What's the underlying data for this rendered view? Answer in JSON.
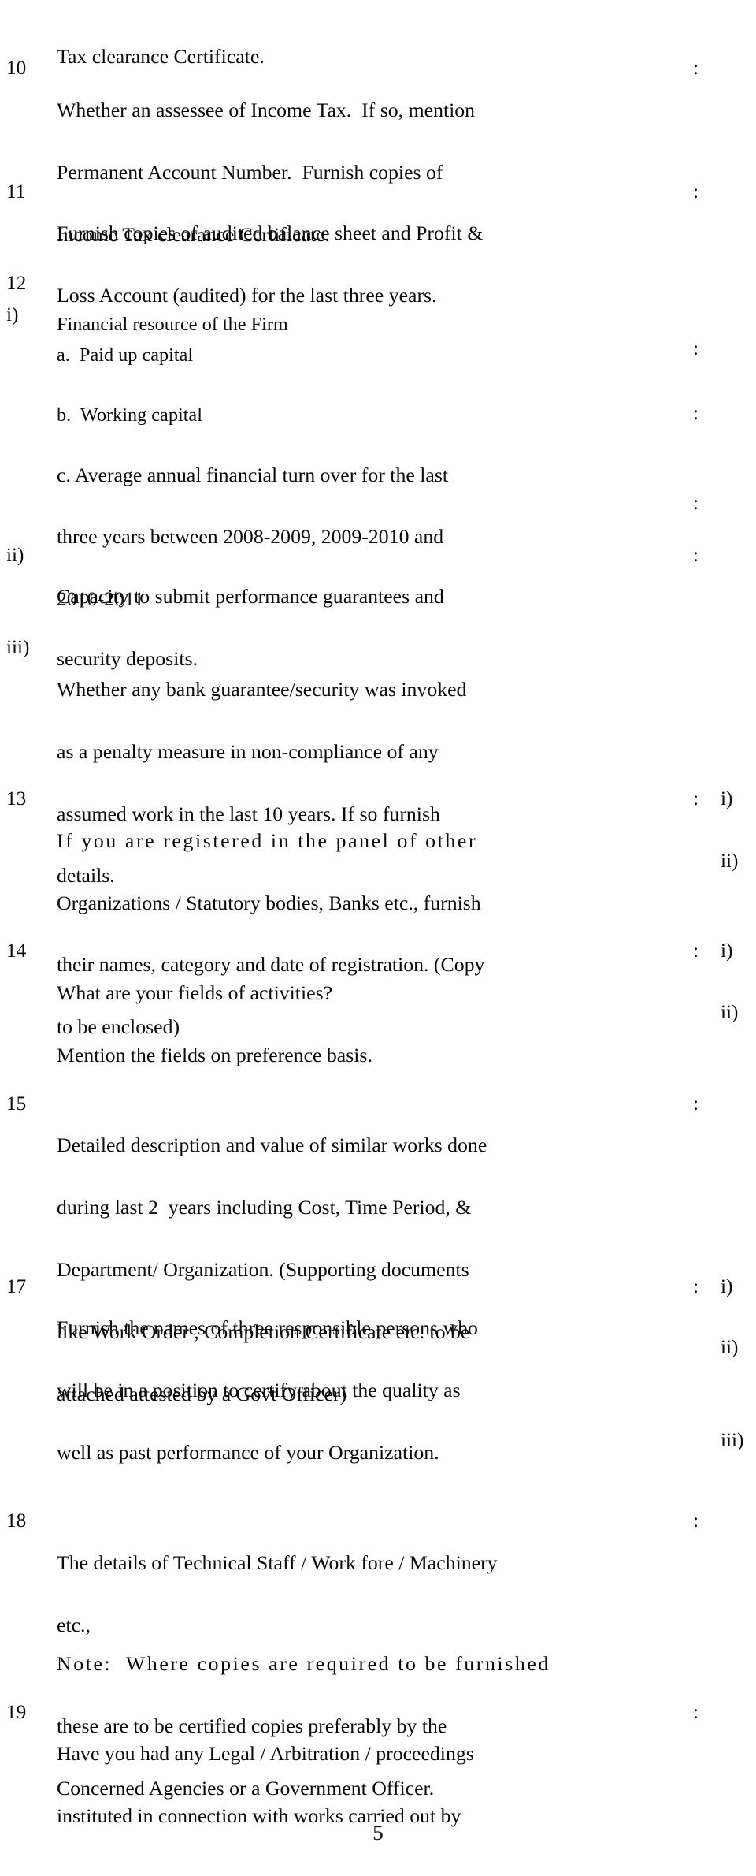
{
  "document": {
    "type": "tender-application-form",
    "page_number": "5"
  },
  "items": [
    {
      "number": "",
      "lines": [
        "Tax clearance Certificate."
      ],
      "colon": "",
      "answers": []
    },
    {
      "number": "10",
      "lines": [
        "Whether an assessee of Income Tax.  If so, mention",
        "Permanent Account Number.  Furnish copies of",
        "Income Tax clearance Certificate."
      ],
      "colon": ":",
      "answers": []
    },
    {
      "number": "11",
      "lines": [
        "Furnish copies of audited balance sheet and Profit &",
        "Loss Account (audited) for the last three years."
      ],
      "colon": ":",
      "answers": []
    },
    {
      "number": "12",
      "lines": [
        "Financial resource of the Firm"
      ],
      "colon": "",
      "answers": []
    },
    {
      "number": "i)",
      "lines": [
        "a.  Paid up capital"
      ],
      "colon": "",
      "answers": []
    },
    {
      "number": "",
      "lines": [
        "b.  Working capital"
      ],
      "colon": ":",
      "answers": []
    },
    {
      "number": "",
      "lines": [
        "c. Average annual financial turn over for the last",
        "three years between 2008-2009, 2009-2010 and",
        "2010-2011"
      ],
      "colon": ":",
      "answers": []
    },
    {
      "number": "ii)",
      "lines": [
        "Capacity to submit performance guarantees and",
        "security deposits."
      ],
      "colon": ":",
      "answers": []
    },
    {
      "number": "iii)",
      "lines": [
        "Whether any bank guarantee/security was invoked",
        "as a penalty measure in non-compliance of any",
        "assumed work in the last 10 years. If so furnish",
        "details."
      ],
      "colon": "",
      "answers": []
    },
    {
      "number": "13",
      "lines": [
        "If you are registered in the panel of other",
        "Organizations / Statutory bodies, Banks etc., furnish",
        "their names, category and date of registration. (Copy",
        "to be enclosed)"
      ],
      "colon": ":",
      "answers": [
        "i)",
        "ii)"
      ]
    },
    {
      "number": "14",
      "lines": [
        "What are your fields of activities?",
        "Mention the fields on preference basis."
      ],
      "colon": ":",
      "answers": [
        "i)",
        "ii)"
      ]
    },
    {
      "number": "15",
      "lines": [
        "Detailed description and value of similar works done",
        "during last 2  years including Cost, Time Period, &",
        "Department/ Organization. (Supporting documents",
        "like Work Order , Completion Certificate etc. to be",
        "attached attested by a Govt Officer)"
      ],
      "colon": ":",
      "answers": []
    },
    {
      "number": "17",
      "lines": [
        "Furnish the names of three responsible persons who",
        "will be in a position to certify about the quality as",
        "well as past performance of your Organization."
      ],
      "colon": ":",
      "answers": [
        "i)",
        "ii)",
        "iii)"
      ]
    },
    {
      "number": "18",
      "lines": [
        "The details of Technical Staff / Work fore / Machinery",
        "etc.,"
      ],
      "colon": ":",
      "answers": []
    },
    {
      "number": "",
      "lines": [
        "Note:  Where copies are required to be furnished",
        "these are to be certified copies preferably by the",
        "Concerned Agencies or a Government Officer."
      ],
      "colon": "",
      "answers": []
    },
    {
      "number": "19",
      "lines": [
        "Have you had any Legal / Arbitration / proceedings",
        "instituted in connection with works carried out by"
      ],
      "colon": ":",
      "answers": []
    }
  ],
  "blocks": {
    "b0_line0": "Tax clearance Certificate.",
    "b1_num": "10",
    "b1_line0": "Whether an assessee of Income Tax.  If so, mention",
    "b1_line1": "Permanent Account Number.  Furnish copies of",
    "b1_line2": "Income Tax clearance Certificate.",
    "b1_colon": ":",
    "b2_num": "11",
    "b2_line0": "Furnish copies of audited balance sheet and Profit &",
    "b2_line1": "Loss Account (audited) for the last three years.",
    "b2_colon": ":",
    "b3_num": "12",
    "b3_line0": "Financial resource of the Firm",
    "b3_romnum": "i)",
    "b3_line1": "a.  Paid up capital",
    "b4_line0": "b.  Working capital",
    "b4_colon": ":",
    "b5_colon": ":",
    "b5_line0": "c. Average annual financial turn over for the last",
    "b5_line1": "three years between 2008-2009, 2009-2010 and",
    "b5_line2": "2010-2011",
    "b5_colon2": ":",
    "b6_num": "ii)",
    "b6_line0": "Capacity to submit performance guarantees and",
    "b6_line1": "security deposits.",
    "b6_colon": ":",
    "b7_num": "iii)",
    "b7_line0": "Whether any bank guarantee/security was invoked",
    "b7_line1": "as a penalty measure in non-compliance of any",
    "b7_line2": "assumed work in the last 10 years. If so furnish",
    "b7_line3": "details.",
    "b8_num": "13",
    "b8_line0": "If you are registered in the panel of other",
    "b8_line1": "Organizations / Statutory bodies, Banks etc., furnish",
    "b8_line2": "their names, category and date of registration. (Copy",
    "b8_line3": "to be enclosed)",
    "b8_colon": ":",
    "b8_ans0": "i)",
    "b8_ans1": "ii)",
    "b9_num": "14",
    "b9_line0": "What are your fields of activities?",
    "b9_line1": "Mention the fields on preference basis.",
    "b9_colon": ":",
    "b9_ans0": "i)",
    "b9_ans1": "ii)",
    "b10_num": "15",
    "b10_line0": "Detailed description and value of similar works done",
    "b10_line1": "during last 2  years including Cost, Time Period, &",
    "b10_line2": "Department/ Organization. (Supporting documents",
    "b10_line3": "like Work Order , Completion Certificate etc. to be",
    "b10_line4": "attached attested by a Govt Officer)",
    "b10_colon": ":",
    "b11_num": "17",
    "b11_line0": "Furnish the names of three responsible persons who",
    "b11_line1": "will be in a position to certify about the quality as",
    "b11_line2": "well as past performance of your Organization.",
    "b11_colon": ":",
    "b11_ans0": "i)",
    "b11_ans1": "ii)",
    "b11_ans2": "iii)",
    "b12_num": "18",
    "b12_line0": "The details of Technical Staff / Work fore / Machinery",
    "b12_line1": "etc.,",
    "b12_colon": ":",
    "b13_line0": "Note:  Where copies are required to be furnished",
    "b13_line1": "these are to be certified copies preferably by the",
    "b13_line2": "Concerned Agencies or a Government Officer.",
    "b14_num": "19",
    "b14_line0": "Have you had any Legal / Arbitration / proceedings",
    "b14_line1": "instituted in connection with works carried out by",
    "b14_colon": ":",
    "folio": "5"
  }
}
